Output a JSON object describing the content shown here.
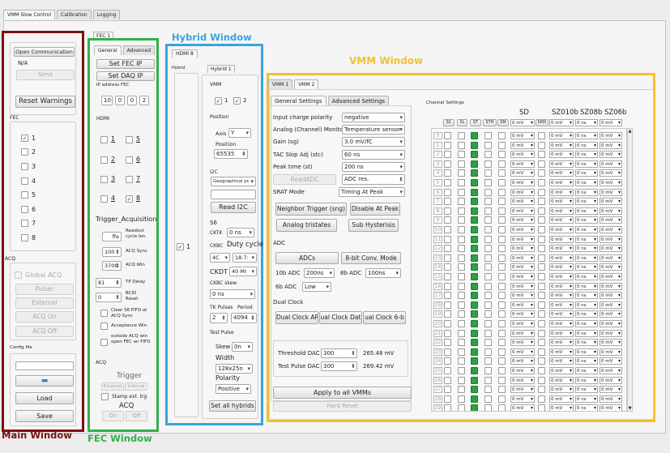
{
  "app_tabs": [
    "VMM Slow Control",
    "Calibration",
    "Logging"
  ],
  "colors": {
    "main_window": "#7a1111",
    "fec_window": "#2fb24a",
    "hybrid_window": "#3aa3dd",
    "vmm_window": "#f2c12e",
    "channel_green": "#2e9f45"
  },
  "icons": {
    "folder": "folder-icon",
    "spin": "spin-arrows-icon",
    "dropdown": "chevron-down-icon"
  },
  "main": {
    "open_comm": "Open Communication",
    "status": "N/A",
    "send": "Send",
    "reset_warnings": "Reset Warnings",
    "fec_label": "FEC",
    "fec_items": [
      "1",
      "2",
      "3",
      "4",
      "5",
      "6",
      "7",
      "8"
    ],
    "acq_label": "ACQ",
    "global_acq": "Global ACQ",
    "pulser": "Pulser",
    "external": "External",
    "acq_on": "ACQ On",
    "acq_off": "ACQ Off",
    "config_label": "Config file",
    "load": "Load",
    "save": "Save"
  },
  "fec": {
    "tab": "FEC 1",
    "subtabs": [
      "General",
      "Advanced"
    ],
    "set_fec_ip": "Set FEC IP",
    "set_daq_ip": "Set DAQ IP",
    "ip_label": "IP address FEC",
    "ip": [
      "10",
      "0",
      "0",
      "2"
    ],
    "hdmi_label": "HDMI",
    "hdmi_items": [
      "1",
      "5",
      "2",
      "6",
      "3",
      "7",
      "4",
      "8"
    ],
    "trigger_title": "Trigger_Acquisition",
    "readout_val": "ffe",
    "readout_label": "Readout cycle len.",
    "acq_sync_val": "100",
    "acq_sync_label": "ACQ Sync",
    "acq_win_val": "370C",
    "acq_win_label": "ACQ Win",
    "tp_delay_val": "81",
    "tp_delay_label": "TP Delay",
    "bcid_val": "0",
    "bcid_label": "BCID Reset",
    "clear_s6": "Clear S6 FIFO at ACQ Sync",
    "acceptance": "Acceptance Win",
    "outside_acq": "outside ACQ win open FEC wr FIFO",
    "acq_group": "ACQ",
    "trigger": "Trigger",
    "external": "External",
    "internal": "Internal",
    "stamp": "Stamp ext. trg",
    "acq": "ACQ",
    "on": "On",
    "off": "Off"
  },
  "hybrid": {
    "tab": "HDMI 8",
    "side_label": "Hybrid",
    "subtab": "Hybrid 1",
    "enable_label": "1",
    "vmm_label": "VMM",
    "vmm_items": [
      "1",
      "2"
    ],
    "position_label": "Position",
    "axis_label": "Axis",
    "axis_val": "Y",
    "pos_label": "Position",
    "pos_val": "65535",
    "i2c_label": "I2C",
    "i2c_combo": "Geographical pc",
    "read_i2c": "Read I2C",
    "s6_label": "S6",
    "cktk_label": "CKTK",
    "cktk_val": "0 ns",
    "ckbc_label": "CKBC",
    "duty_label": "Duty cycle",
    "ckbc_val": "4C",
    "duty_val": "18.7:",
    "ckdt_label": "CKDT",
    "ckdt_val": "40 MI",
    "ckbc_skew_label": "CKBC skew",
    "ckbc_skew_val": "0 ns",
    "tk_label": "TK Pulses",
    "period_label": "Period",
    "tk_val": "2",
    "period_val": "4094",
    "test_pulse_label": "Test Pulse",
    "skew_label": "Skew",
    "skew_val": "0n",
    "width_label": "Width",
    "width_val": "128x25n",
    "polarity_label": "Polarity",
    "polarity_val": "Positive",
    "set_all": "Set all hybrids"
  },
  "vmm": {
    "tabs": [
      "VMM 1",
      "VMM 2"
    ],
    "subtabs": [
      "General Settings",
      "Advanced Settings"
    ],
    "settings": [
      {
        "label": "Input charge polarity",
        "value": "negative"
      },
      {
        "label": "Analog (Channel) Monitor",
        "value": "Temperature sensor"
      },
      {
        "label": "Gain (sg)",
        "value": "3.0 mV/fC"
      },
      {
        "label": "TAC Slop Adj (stc)",
        "value": "60 ns"
      },
      {
        "label": "Peak time (st)",
        "value": "200 ns"
      }
    ],
    "read_adc": "ReadADC",
    "adc_res": "ADC res.",
    "srat_label": "SRAT Mode",
    "srat_val": "Timing At Peak",
    "neighbor": "Neighbor Trigger (sng)",
    "disable_peak": "Disable At Peak",
    "analog_tri": "Analog tristates",
    "sub_hyst": "Sub Hysterisis",
    "adc_label": "ADC",
    "adcs": "ADCs",
    "conv8": "8-bit Conv. Mode",
    "adc10_label": "10b ADC",
    "adc10_val": "200ns",
    "adc8_label": "8b ADC",
    "adc8_val": "100ns",
    "adc6_label": "6b ADC",
    "adc6_val": "Low",
    "dual_label": "Dual Clock",
    "dual1": "Dual Clock AR",
    "dual2": "ual Clock Dat",
    "dual3": "ual Clock 6-b",
    "threshold_label": "Threshold DAC",
    "threshold_val": "300",
    "threshold_mv": "265.48 mV",
    "testpulse_label": "Test Pulse DAC",
    "testpulse_val": "300",
    "testpulse_mv": "269.42 mV",
    "apply_all": "Apply to all VMMs",
    "hard_reset": "Hard Reset",
    "channel_label": "Channel Settings",
    "sd": "SD",
    "sz010b": "SZ010b",
    "sz08b": "SZ08b",
    "sz06b": "SZ06b",
    "headers": [
      "SC",
      "SL",
      "ST",
      "STH",
      "SM",
      "SMX"
    ],
    "header_vals": [
      "0 mV",
      "0 mV",
      "0 ns",
      "0 mV"
    ],
    "row_vals": [
      "0 mV",
      "0 mV",
      "0 ns",
      "0 mV"
    ],
    "channels": [
      "0",
      "1",
      "2",
      "3",
      "4",
      "5",
      "6",
      "7",
      "8",
      "9",
      "10",
      "11",
      "12",
      "13",
      "14",
      "15",
      "16",
      "17",
      "18",
      "19",
      "20",
      "21",
      "22",
      "23",
      "24",
      "25",
      "26",
      "27",
      "28",
      "29"
    ]
  },
  "captions": {
    "main": "Main Window",
    "fec": "FEC Window",
    "hybrid": "Hybrid Window",
    "vmm": "VMM Window"
  }
}
